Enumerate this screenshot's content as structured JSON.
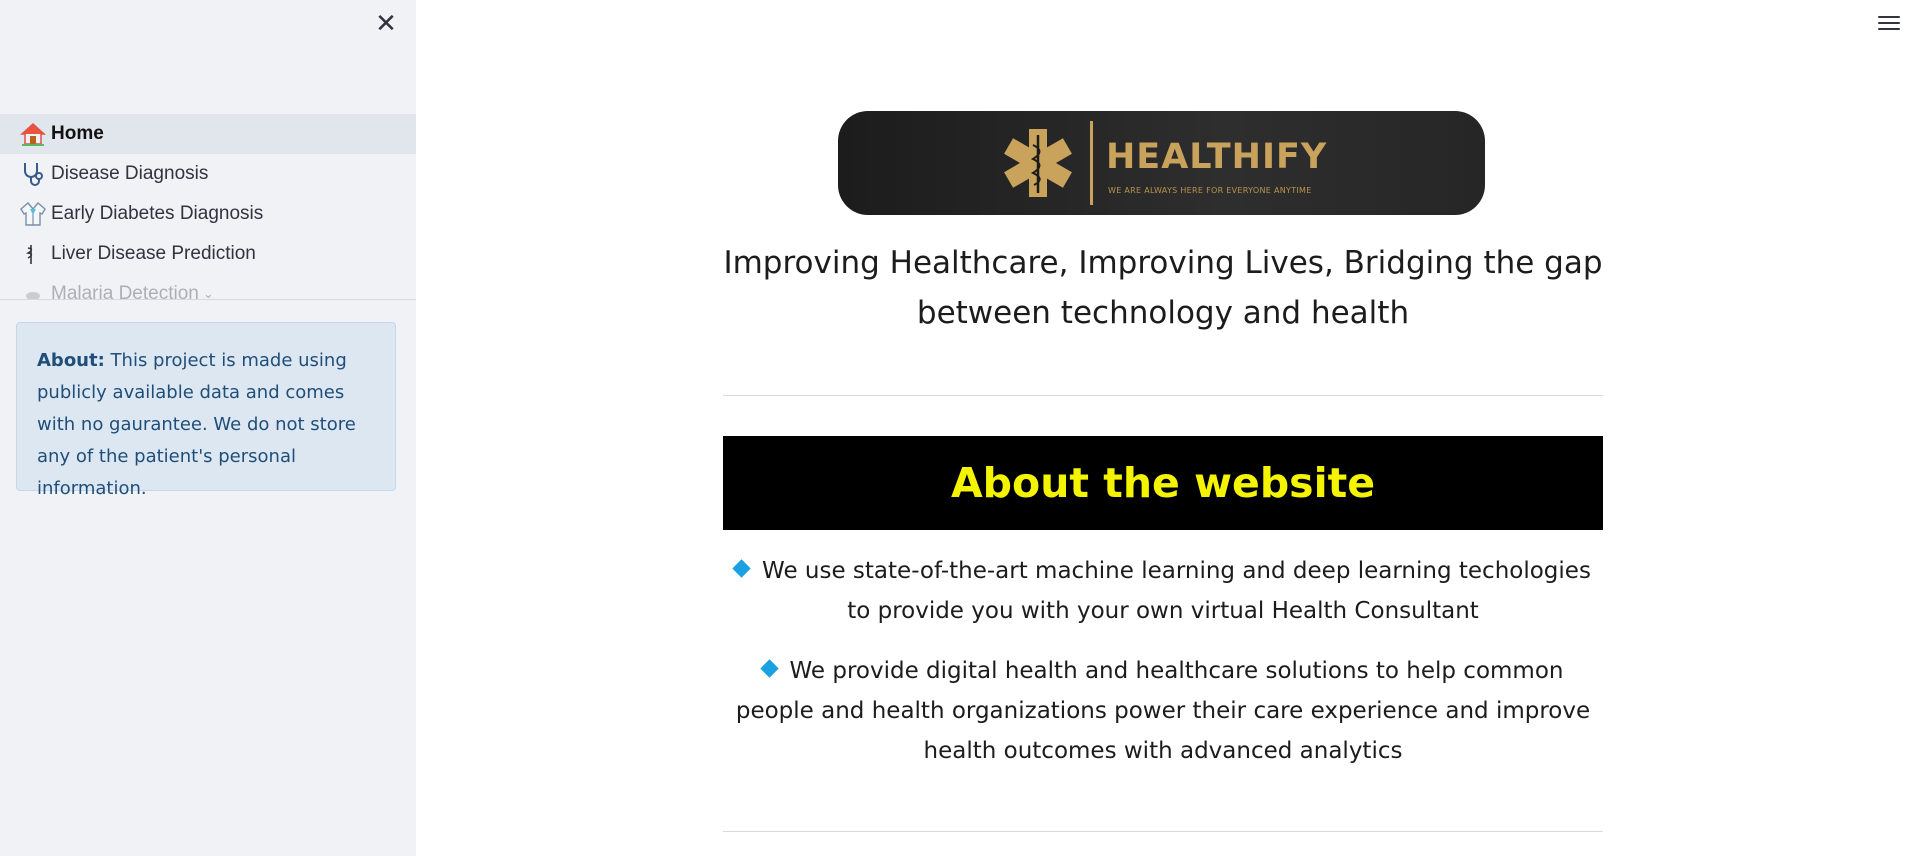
{
  "sidebar": {
    "close_glyph": "✕",
    "items": [
      {
        "label": "Home",
        "icon": "house-icon"
      },
      {
        "label": "Disease Diagnosis",
        "icon": "stethoscope-icon"
      },
      {
        "label": "Early Diabetes Diagnosis",
        "icon": "lab-coat-icon"
      },
      {
        "label": "Liver Disease Prediction",
        "icon": "caduceus-icon"
      },
      {
        "label": "Malaria Detection",
        "icon": "mosquito-icon"
      }
    ],
    "about_bold": "About:",
    "about_text": " This project is made using publicly available data and comes with no gaurantee. We do not store any of the patient's personal information."
  },
  "main": {
    "logo": {
      "title": "HEALTHIFY",
      "subtitle": "WE ARE ALWAYS HERE FOR EVERYONE ANYTIME"
    },
    "tagline": "Improving Healthcare, Improving Lives, Bridging the gap between technology and health",
    "section_title": "About the website",
    "bullets": [
      "We use state-of-the-art machine learning and deep learning techologies to provide you with your own virtual Health Consultant",
      "We provide digital health and healthcare solutions to help common people and health organizations power their care experience and improve health outcomes with advanced analytics"
    ]
  },
  "colors": {
    "sidebar_bg": "#f0f2f6",
    "banner_bg": "#000000",
    "banner_text": "#f4f400",
    "bullet_diamond": "#1ba1e2",
    "logo_gold": "#c9a25b"
  }
}
